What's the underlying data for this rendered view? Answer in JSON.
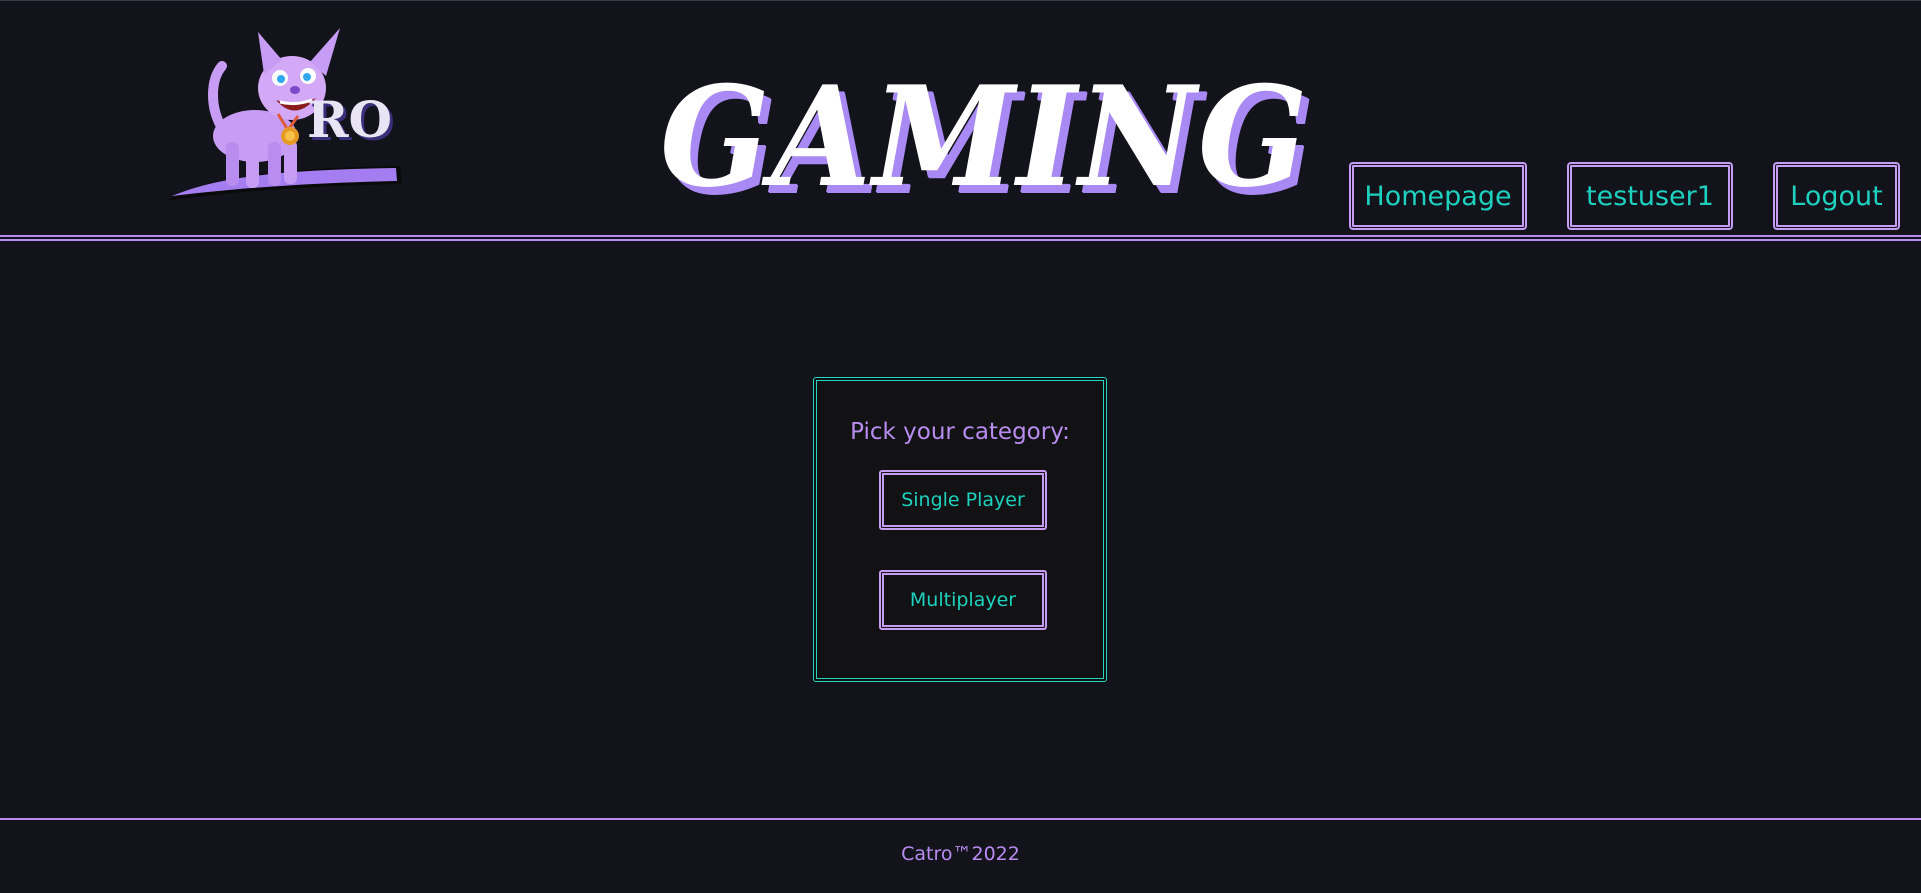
{
  "header": {
    "logo": {
      "text": "RO",
      "icon": "cat-mascot-icon"
    },
    "wordmark": "GAMING",
    "nav": {
      "homepage_label": "Homepage",
      "user_label": "testuser1",
      "logout_label": "Logout"
    }
  },
  "main": {
    "category_prompt": "Pick your category:",
    "categories": [
      {
        "label": "Single Player"
      },
      {
        "label": "Multiplayer"
      }
    ]
  },
  "footer": {
    "text": "Catro™2022"
  },
  "colors": {
    "background": "#13131c",
    "accent_purple": "#b98cf0",
    "accent_teal": "#1ed0be",
    "wordmark_shadow": "#a98af5"
  }
}
